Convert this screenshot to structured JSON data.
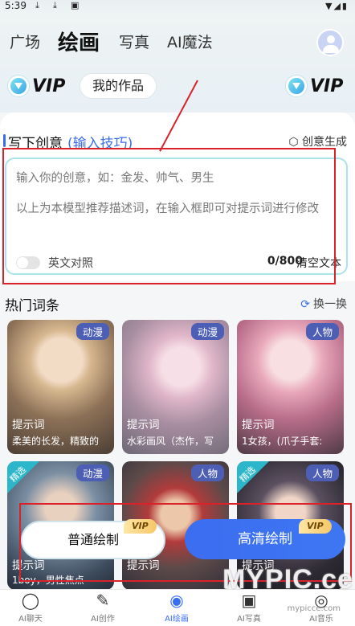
{
  "status_bar": {
    "time": "5:39"
  },
  "nav": {
    "tabs": [
      {
        "label": "广场"
      },
      {
        "label": "绘画"
      },
      {
        "label": "写真"
      },
      {
        "label": "AI魔法"
      }
    ],
    "active": "绘画"
  },
  "vip": {
    "left_label": "VIP",
    "right_label": "VIP"
  },
  "my_works": "我的作品",
  "creative": {
    "title": "写下创意",
    "tip_link": "(输入技巧)",
    "generate": "创意生成",
    "placeholder": "输入你的创意，如：金发、帅气、男生",
    "description": "以上为本模型推荐描述词，在输入框即可对提示词进行修改",
    "toggle_label": "英文对照",
    "counter": "0/800",
    "clear": "清空文本"
  },
  "hot": {
    "title": "热门词条",
    "refresh": "换一换",
    "cards": [
      {
        "tag": "动漫",
        "label": "提示词",
        "sub": "柔美的长发，精致的",
        "featured": false
      },
      {
        "tag": "动漫",
        "label": "提示词",
        "sub": "水彩画风（杰作，写",
        "featured": false
      },
      {
        "tag": "人物",
        "label": "提示词",
        "sub": "1女孩，(爪子手套:",
        "featured": false
      },
      {
        "tag": "动漫",
        "label": "提示词",
        "sub": "1boy，男性焦点",
        "featured": true,
        "featured_label": "精选"
      },
      {
        "tag": "人物",
        "label": "提示词",
        "sub": "",
        "featured": false
      },
      {
        "tag": "人物",
        "label": "提示词",
        "sub": "",
        "featured": true,
        "featured_label": "精选"
      }
    ]
  },
  "actions": {
    "normal": "普通绘制",
    "hd": "高清绘制",
    "vip_badge": "VIP"
  },
  "bottom_tabs": [
    {
      "label": "AI聊天",
      "icon": "chat-icon"
    },
    {
      "label": "AI创作",
      "icon": "pen-icon"
    },
    {
      "label": "AI绘画",
      "icon": "palette-icon"
    },
    {
      "label": "AI写真",
      "icon": "image-icon"
    },
    {
      "label": "AI音乐",
      "icon": "disc-icon"
    }
  ],
  "watermark": {
    "text": "MYPIC.ce",
    "sub": "mypicce.com"
  },
  "colors": {
    "accent": "#3b6df0",
    "annotation_red": "#d9222a",
    "tag_bg": "#4c5fb4",
    "featured": "#2bb7c9"
  }
}
